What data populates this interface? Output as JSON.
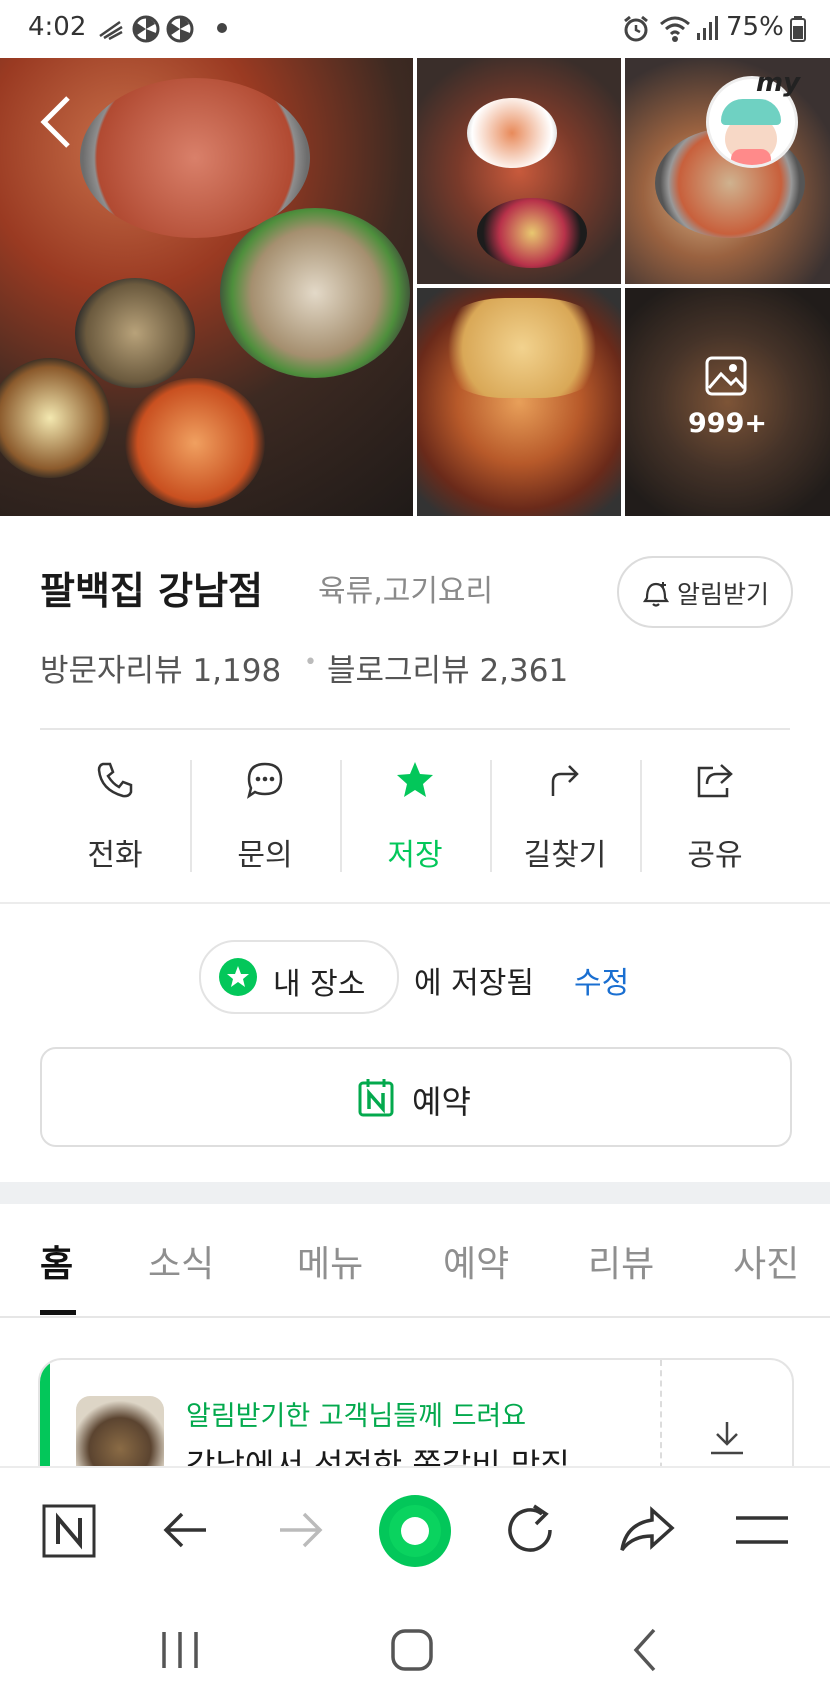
{
  "status_bar": {
    "time": "4:02",
    "battery": "75%"
  },
  "photos": {
    "count_label": "999+",
    "my_badge": "my"
  },
  "place": {
    "name": "팔백집 강남점",
    "category": "육류,고기요리",
    "notify_label": "알림받기",
    "visitor_reviews": "방문자리뷰 1,198",
    "dot": "•",
    "blog_reviews": "블로그리뷰 2,361"
  },
  "actions": [
    {
      "label": "전화"
    },
    {
      "label": "문의"
    },
    {
      "label": "저장"
    },
    {
      "label": "길찾기"
    },
    {
      "label": "공유"
    }
  ],
  "saved": {
    "chip_label": "내 장소",
    "saved_text": "에 저장됨",
    "edit_label": "수정"
  },
  "reservation": {
    "label": "예약"
  },
  "tabs": [
    {
      "label": "홈"
    },
    {
      "label": "소식"
    },
    {
      "label": "메뉴"
    },
    {
      "label": "예약"
    },
    {
      "label": "리뷰"
    },
    {
      "label": "사진"
    }
  ],
  "news": {
    "tag": "알림받기한 고객님들께 드려요",
    "title": "강남에서 선정한 쪽갈비 맛집 ..."
  },
  "colors": {
    "brand_green": "#03c75a",
    "link_blue": "#1a6fd1"
  }
}
